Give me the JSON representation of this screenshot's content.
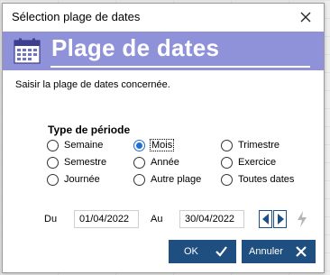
{
  "window": {
    "title": "Sélection plage de dates"
  },
  "banner": {
    "title": "Plage de dates"
  },
  "instruction": "Saisir la plage de dates concernée.",
  "period_group": {
    "title": "Type de période",
    "options": [
      {
        "label": "Semaine",
        "selected": false
      },
      {
        "label": "Mois",
        "selected": true
      },
      {
        "label": "Trimestre",
        "selected": false
      },
      {
        "label": "Semestre",
        "selected": false
      },
      {
        "label": "Année",
        "selected": false
      },
      {
        "label": "Exercice",
        "selected": false
      },
      {
        "label": "Journée",
        "selected": false
      },
      {
        "label": "Autre plage",
        "selected": false
      },
      {
        "label": "Toutes dates",
        "selected": false
      }
    ]
  },
  "range": {
    "from_label": "Du",
    "from_value": "01/04/2022",
    "to_label": "Au",
    "to_value": "30/04/2022"
  },
  "buttons": {
    "ok": "OK",
    "cancel": "Annuler"
  },
  "colors": {
    "banner": "#8f91d9",
    "button": "#1f4f80",
    "radio_selected": "#1f6fd6"
  },
  "icons": [
    "calendar-icon",
    "close-icon",
    "chevron-left-icon",
    "chevron-right-icon",
    "lightning-icon",
    "checkmark-icon",
    "x-icon"
  ]
}
